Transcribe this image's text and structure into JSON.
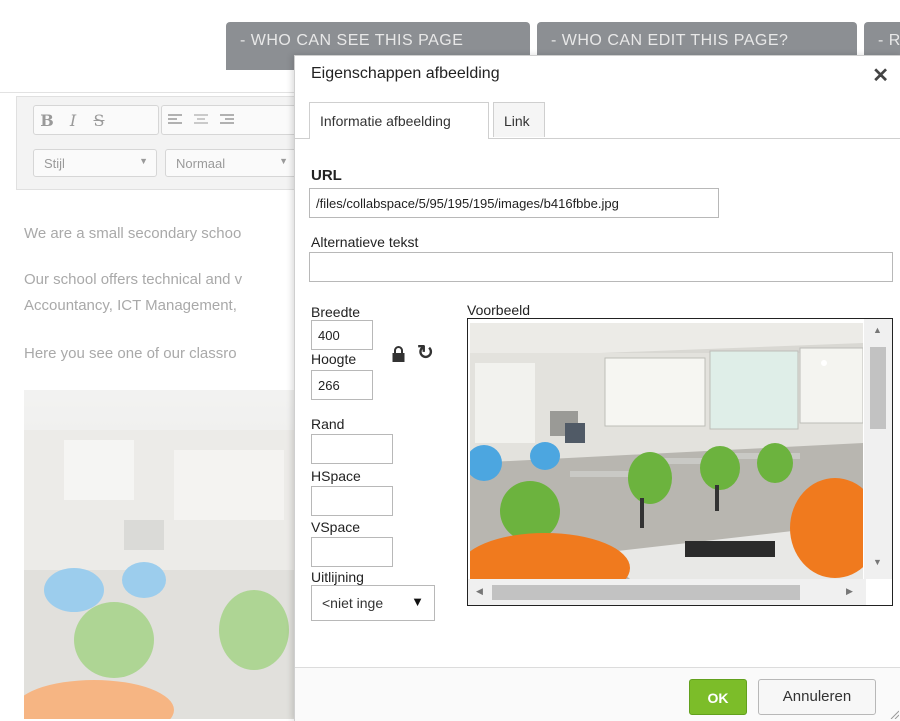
{
  "page": {
    "top_buttons": [
      "- WHO CAN SEE THIS PAGE",
      "- WHO CAN EDIT THIS PAGE?",
      "- R"
    ],
    "toolbar": {
      "format_buttons": [
        "B",
        "I",
        "S"
      ],
      "style_combo": "Stijl",
      "format_combo": "Normaal"
    },
    "paragraphs": [
      "We are a small secondary schoo",
      "Our school offers technical and v",
      "Accountancy, ICT Management,",
      "Here you see one of our classro"
    ]
  },
  "dialog": {
    "title": "Eigenschappen afbeelding",
    "tabs": [
      {
        "label": "Informatie afbeelding",
        "active": true
      },
      {
        "label": "Link",
        "active": false
      }
    ],
    "url": {
      "label": "URL",
      "value": "/files/collabspace/5/95/195/195/images/b416fbbe.jpg"
    },
    "alt_text": {
      "label": "Alternatieve tekst",
      "value": ""
    },
    "width": {
      "label": "Breedte",
      "value": "400"
    },
    "height": {
      "label": "Hoogte",
      "value": "266"
    },
    "border": {
      "label": "Rand",
      "value": ""
    },
    "hspace": {
      "label": "HSpace",
      "value": ""
    },
    "vspace": {
      "label": "VSpace",
      "value": ""
    },
    "alignment": {
      "label": "Uitlijning",
      "value": "<niet inge"
    },
    "preview_label": "Voorbeeld",
    "ok_label": "OK",
    "cancel_label": "Annuleren"
  },
  "colors": {
    "ok_green": "#7cbd29",
    "tab_button_gray": "#8c8f93",
    "chair_green": "#6cb33e",
    "chair_orange": "#f07a1e",
    "chair_blue": "#4ca6e0"
  }
}
